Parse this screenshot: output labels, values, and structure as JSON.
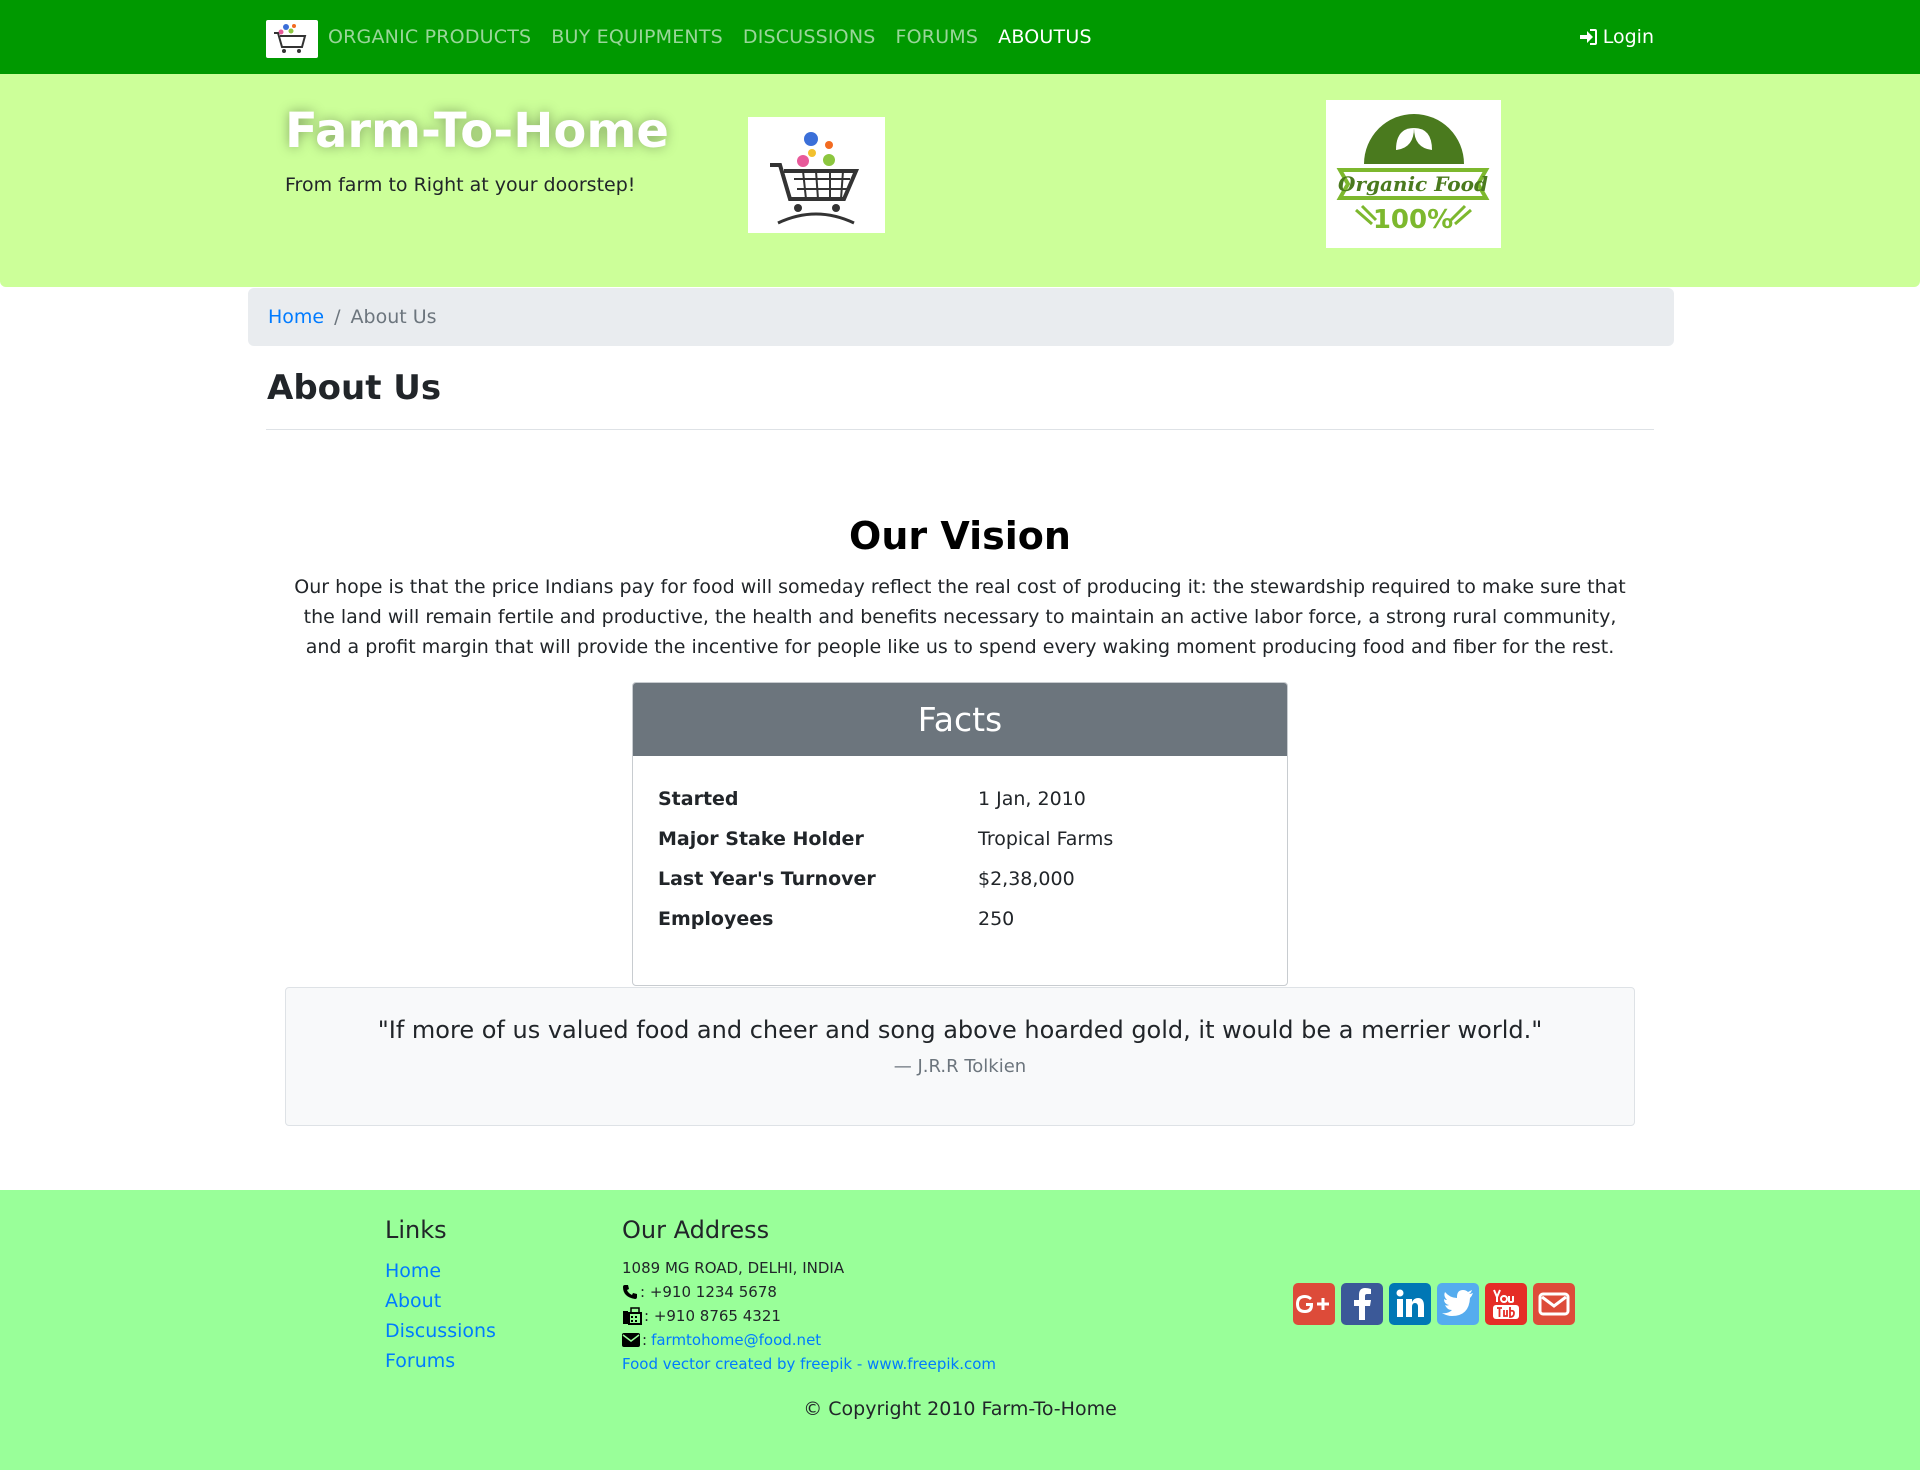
{
  "nav": {
    "logo_icon": "cart-logo-icon",
    "links": [
      {
        "label": "ORGANIC PRODUCTS",
        "active": false
      },
      {
        "label": "BUY EQUIPMENTS",
        "active": false
      },
      {
        "label": "DISCUSSIONS",
        "active": false
      },
      {
        "label": "FORUMS",
        "active": false
      },
      {
        "label": "ABOUTUS",
        "active": true
      }
    ],
    "login_label": "Login",
    "login_icon": "sign-in-icon"
  },
  "header": {
    "title": "Farm-To-Home",
    "subtitle": "From farm to Right at your doorstep!",
    "organic_logo": {
      "line1": "Organic Food",
      "line2": "100%"
    }
  },
  "breadcrumb": {
    "home": "Home",
    "separator": "/",
    "current": "About Us"
  },
  "page_title": "About Us",
  "vision": {
    "title": "Our Vision",
    "text": "Our hope is that the price Indians pay for food will someday reflect the real cost of producing it: the stewardship required to make sure that the land will remain fertile and productive, the health and benefits necessary to maintain an active labor force, a strong rural community, and a profit margin that will provide the incentive for people like us to spend every waking moment producing food and fiber for the rest."
  },
  "facts": {
    "title": "Facts",
    "rows": [
      {
        "key": "Started",
        "value": "1 Jan, 2010"
      },
      {
        "key": "Major Stake Holder",
        "value": "Tropical Farms"
      },
      {
        "key": "Last Year's Turnover",
        "value": "$2,38,000"
      },
      {
        "key": "Employees",
        "value": "250"
      }
    ]
  },
  "quote": {
    "text": "\"If more of us valued food and cheer and song above hoarded gold, it would be a merrier world.\"",
    "author": "— J.R.R Tolkien"
  },
  "footer": {
    "links_title": "Links",
    "links": [
      "Home",
      "About",
      "Discussions",
      "Forums"
    ],
    "address_title": "Our Address",
    "address": "1089 MG ROAD, DELHI, INDIA",
    "phone": ": +910 1234 5678",
    "fax": ": +910 8765 4321",
    "email_prefix": ":",
    "email": "farmtohome@food.net",
    "credit": "Food vector created by freepik - www.freepik.com",
    "social": [
      {
        "icon": "google-plus-icon",
        "color": "#dd4b39"
      },
      {
        "icon": "facebook-icon",
        "color": "#3b5998"
      },
      {
        "icon": "linkedin-icon",
        "color": "#0077b5"
      },
      {
        "icon": "twitter-icon",
        "color": "#55acee"
      },
      {
        "icon": "youtube-icon",
        "color": "#e52d27"
      },
      {
        "icon": "mail-icon",
        "color": "#dd4b39"
      }
    ],
    "copyright": "© Copyright 2010 Farm-To-Home"
  },
  "colors": {
    "navbar": "#009900",
    "jumbotron": "#ccff99",
    "footer": "#99ff99",
    "link": "#007bff",
    "facts_header": "#6c757d"
  }
}
